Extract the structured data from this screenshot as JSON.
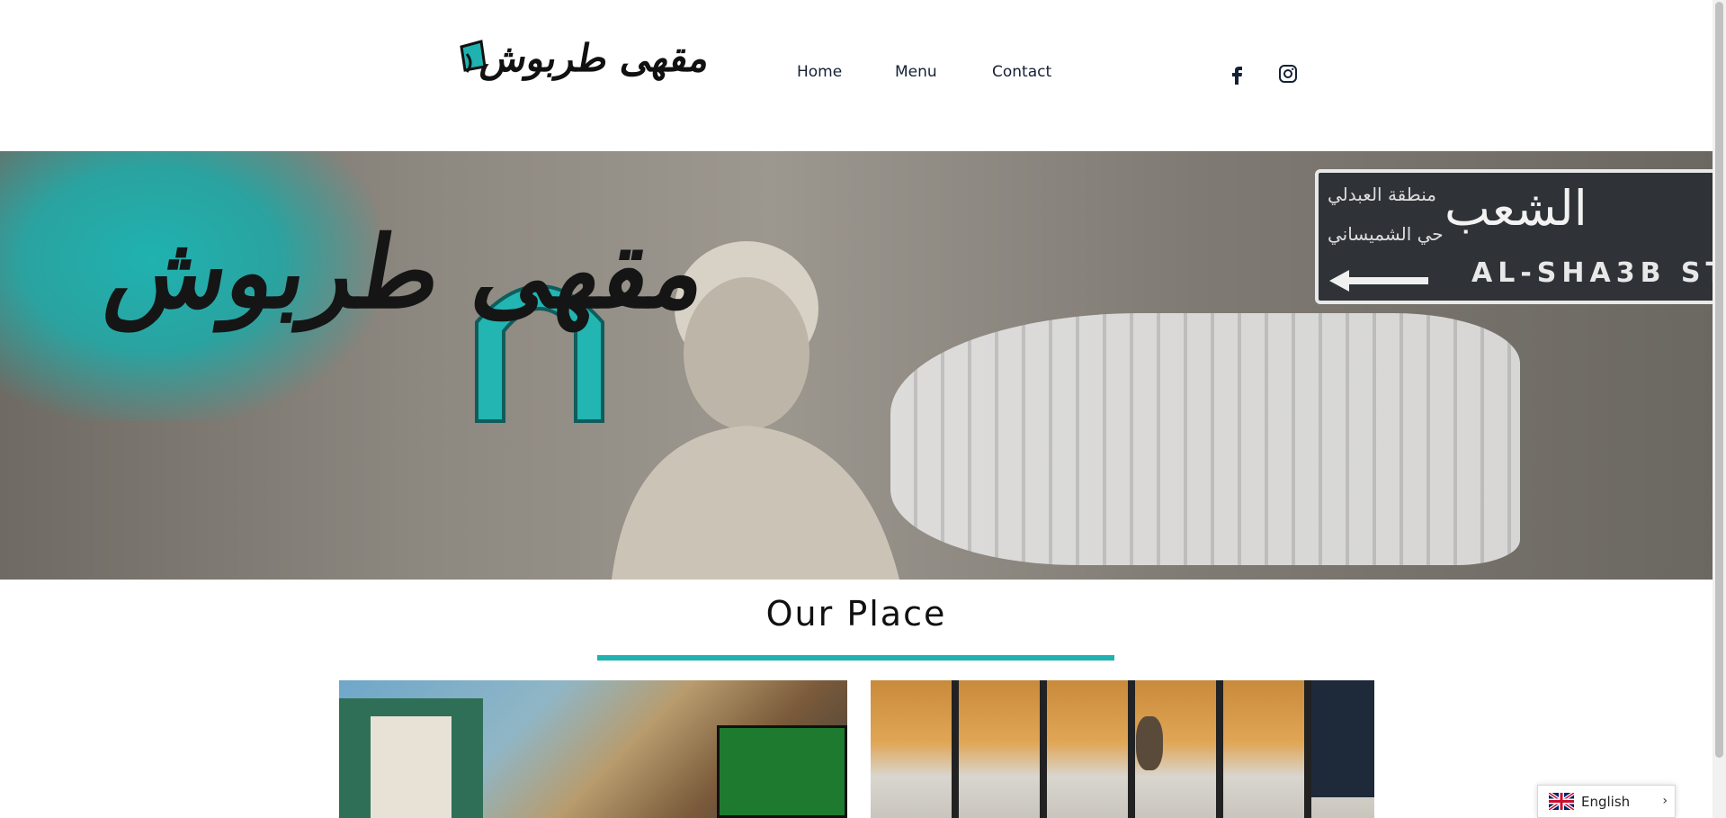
{
  "brand": {
    "logo_text": "مقهى طربوش",
    "accent_color": "#1fb2b0"
  },
  "nav": {
    "home": "Home",
    "menu": "Menu",
    "contact": "Contact"
  },
  "social": {
    "facebook_icon": "facebook-icon",
    "instagram_icon": "instagram-icon"
  },
  "hero": {
    "logo_text": "مقهى طربوش",
    "sign_arabic": "الشعب",
    "sign_latin": "AL-SHA3B ST",
    "sign_small_1": "منطقة العبدلي",
    "sign_small_2": "حي الشميساني"
  },
  "section": {
    "title": "Our Place"
  },
  "language": {
    "label": "English",
    "icon": "uk-flag-icon"
  }
}
